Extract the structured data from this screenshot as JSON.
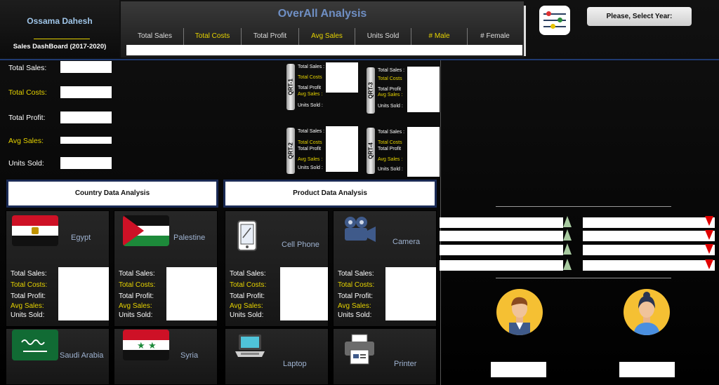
{
  "brand": {
    "name": "Ossama Dahesh",
    "subtitle": "Sales DashBoard (2017-2020)"
  },
  "overall": {
    "title": "OverAll Analysis",
    "columns": [
      "Total Sales",
      "Total Costs",
      "Total Profit",
      "Avg Sales",
      "Units Sold",
      "# Male",
      "# Female"
    ]
  },
  "year_button": "Please, Select Year:",
  "left_kpis": [
    "Total Sales:",
    "Total Costs:",
    "Total Profit:",
    "Avg Sales:",
    "Units Sold:"
  ],
  "quarters": [
    {
      "tab": "QRT-1",
      "labels": [
        "Total Sales :",
        "Total Costs",
        "Total Profit",
        "Avg Sales :",
        "Units Sold :"
      ]
    },
    {
      "tab": "QRT-3",
      "labels": [
        "Total Sales :",
        "Total Costs",
        "Total Profit",
        "Avg Sales :",
        "Units Sold :"
      ]
    },
    {
      "tab": "QRT-2",
      "labels": [
        "Total Sales :",
        "Total Costs",
        "Total Profit",
        "Avg Sales :",
        "Units Sold :"
      ]
    },
    {
      "tab": "QRT-4",
      "labels": [
        "Total Sales :",
        "Total Costs",
        "Total Profit",
        "Avg Sales :",
        "Units Sold :"
      ]
    }
  ],
  "sections": {
    "country": "Country Data Analysis",
    "product": "Product Data Analysis"
  },
  "tile_labels": [
    "Total Sales:",
    "Total Costs:",
    "Total Profit:",
    "Avg Sales:",
    "Units Sold:"
  ],
  "countries": [
    "Egypt",
    "Palestine",
    "Saudi Arabia",
    "Syria"
  ],
  "products": [
    "Cell Phone",
    "Camera",
    "Laptop",
    "Printer"
  ],
  "colors": {
    "accent_yellow": "#e6d300",
    "title_blue": "#6f8fc4",
    "up_green": "#a8caa0",
    "down_red": "#e00000"
  },
  "icons": [
    "sliders-icon",
    "cell-phone-icon",
    "camera-icon",
    "laptop-icon",
    "printer-icon",
    "male-avatar-icon",
    "female-avatar-icon",
    "up-arrow-icon",
    "down-arrow-icon"
  ]
}
